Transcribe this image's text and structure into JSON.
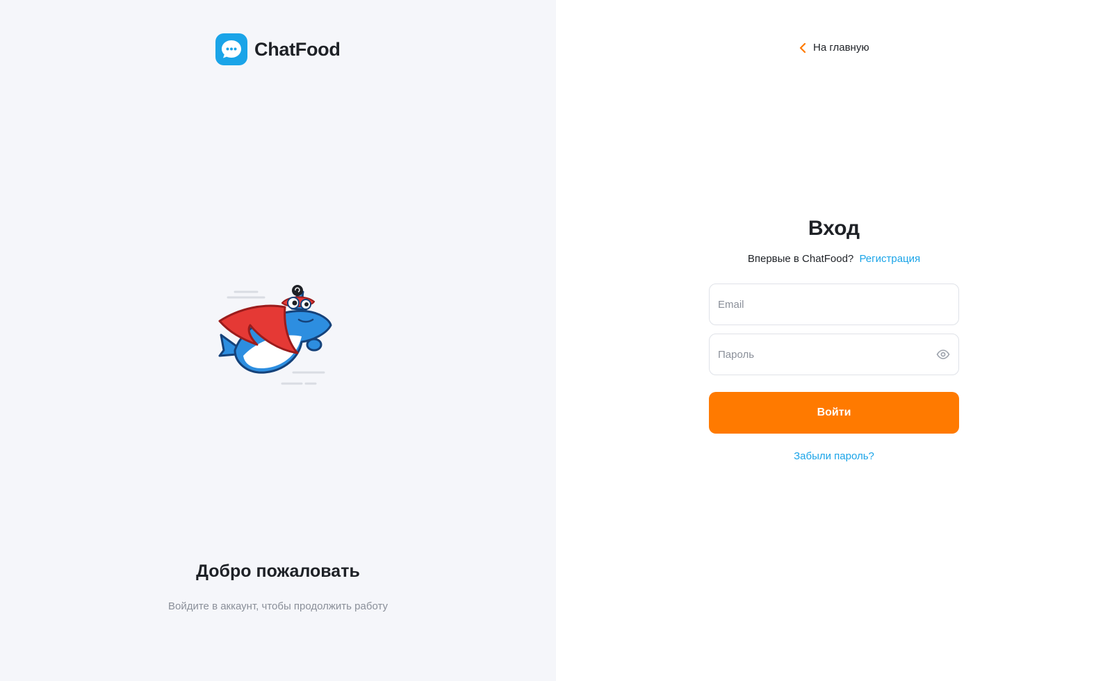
{
  "brand": {
    "name": "ChatFood",
    "icon": "chat-bubble-icon",
    "color": "#1aa4e8"
  },
  "welcome": {
    "title": "Добро пожаловать",
    "subtitle": "Войдите в аккаунт, чтобы продолжить работу"
  },
  "nav": {
    "back_label": "На главную",
    "back_icon": "chevron-left-icon"
  },
  "login": {
    "title": "Вход",
    "first_time_text": "Впервые в ChatFood?",
    "register_link": "Регистрация",
    "email": {
      "value": "",
      "placeholder": "Email"
    },
    "password": {
      "value": "",
      "placeholder": "Пароль",
      "toggle_icon": "eye-icon"
    },
    "submit_label": "Войти",
    "forgot_link": "Забыли пароль?"
  },
  "colors": {
    "accent": "#ff7a00",
    "link": "#1aa4e8",
    "left_background": "#f5f6fa",
    "text": "#1e2126",
    "muted": "#8a8f99"
  }
}
